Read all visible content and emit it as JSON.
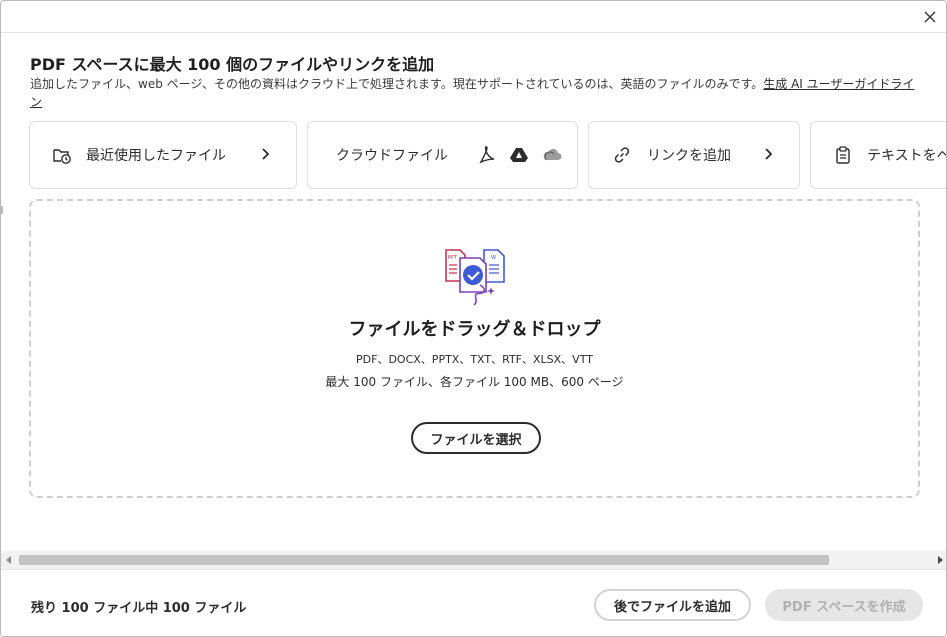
{
  "dialog": {
    "close_label": "×"
  },
  "header": {
    "title": "PDF スペースに最大 100 個のファイルやリンクを追加",
    "subtitle_text": "追加したファイル、web ページ、その他の資料はクラウド上で処理されます。現在サポートされているのは、英語のファイルのみです。",
    "subtitle_link": "生成 AI ユーザーガイドライン"
  },
  "cards": [
    {
      "label": "最近使用したファイル",
      "icon": "recent-files-icon",
      "chevron": "›"
    },
    {
      "label": "クラウドファイル",
      "icons": [
        "acrobat-icon",
        "google-drive-icon",
        "cloud-icon"
      ]
    },
    {
      "label": "リンクを追加",
      "icon": "link-icon",
      "chevron": "›"
    },
    {
      "label": "テキストをペ",
      "icon": "clipboard-icon"
    }
  ],
  "dropzone": {
    "title": "ファイルをドラッグ＆ドロップ",
    "formats": "PDF、DOCX、PPTX、TXT、RTF、XLSX、VTT",
    "limits": "最大 100 ファイル、各ファイル 100 MB、600 ページ",
    "select_button": "ファイルを選択",
    "illustration_labels": {
      "left_doc": "PPT",
      "right_doc": "W"
    }
  },
  "footer": {
    "remaining": "残り 100 ファイル中 100 ファイル",
    "add_later_button": "後でファイルを追加",
    "create_button": "PDF スペースを作成"
  },
  "colors": {
    "accent_purple": "#7a3fb6",
    "accent_red": "#c7334b",
    "accent_blue": "#3e5bd6",
    "disabled_bg": "#e6e6e6"
  }
}
